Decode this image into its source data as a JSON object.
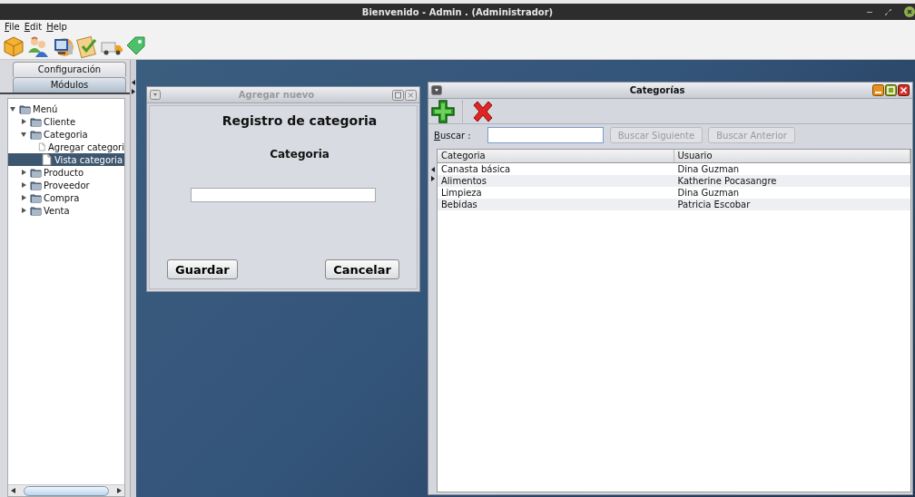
{
  "window": {
    "title": "Bienvenido - Admin . (Administrador)"
  },
  "menu": [
    {
      "label": "File",
      "mnemonic_underlined": true
    },
    {
      "label": "Edit",
      "mnemonic_underlined": true
    },
    {
      "label": "Help",
      "mnemonic_underlined": true
    }
  ],
  "side_tabs": [
    {
      "label": "Configuración",
      "selected": false
    },
    {
      "label": "Módulos",
      "selected": true
    }
  ],
  "tree": {
    "label": "Menú",
    "kind": "folder",
    "expanded": true,
    "selected": false,
    "children": [
      {
        "label": "Cliente",
        "kind": "folder",
        "expanded": false,
        "selected": false
      },
      {
        "label": "Categoria",
        "kind": "folder",
        "expanded": true,
        "selected": false,
        "children": [
          {
            "label": "Agregar categori",
            "kind": "document",
            "selected": false
          },
          {
            "label": "Vista categoria",
            "kind": "document",
            "selected": true
          }
        ]
      },
      {
        "label": "Producto",
        "kind": "folder",
        "expanded": false,
        "selected": false
      },
      {
        "label": "Proveedor",
        "kind": "folder",
        "expanded": false,
        "selected": false
      },
      {
        "label": "Compra",
        "kind": "folder",
        "expanded": false,
        "selected": false
      },
      {
        "label": "Venta",
        "kind": "folder",
        "expanded": false,
        "selected": false
      }
    ]
  },
  "add_window": {
    "title": "Agregar nuevo",
    "active": false,
    "heading": "Registro de categoria",
    "field_label": "Categoria",
    "buttons": [
      "Guardar",
      "Cancelar"
    ]
  },
  "list_window": {
    "title": "Categorías",
    "active": true,
    "search_label": "Buscar :",
    "search_mnemonic_underlined": true,
    "search_buttons": [
      {
        "label": "Buscar Siguiente",
        "disabled": true
      },
      {
        "label": "Buscar Anterior",
        "disabled": true
      }
    ],
    "columns": [
      "Categoria",
      "Usuario"
    ],
    "rows": [
      [
        "Canasta básica",
        "Dina Guzman"
      ],
      [
        "Alimentos",
        "Katherine Pocasangre"
      ],
      [
        "Limpieza",
        "Dina Guzman"
      ],
      [
        "Bebidas",
        "Patricia Escobar"
      ]
    ]
  }
}
